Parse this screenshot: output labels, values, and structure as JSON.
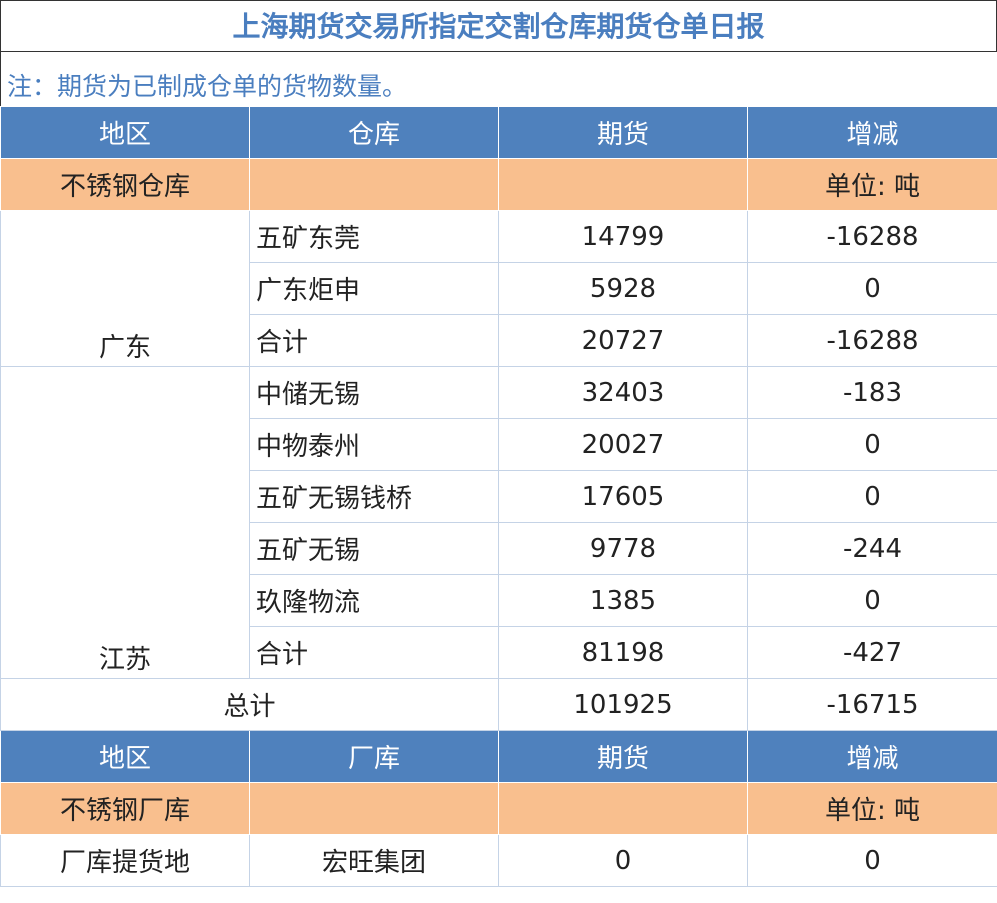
{
  "title": "上海期货交易所指定交割仓库期货仓单日报",
  "note": "注：期货为已制成仓单的货物数量。",
  "headers1": [
    "地区",
    "仓库",
    "期货",
    "增减"
  ],
  "category1": {
    "name": "不锈钢仓库",
    "unit": "单位: 吨"
  },
  "guangdong": {
    "region": "广东",
    "rows": [
      {
        "name": "五矿东莞",
        "futures": "14799",
        "change": "-16288"
      },
      {
        "name": "广东炬申",
        "futures": "5928",
        "change": "0"
      },
      {
        "name": "合计",
        "futures": "20727",
        "change": "-16288"
      }
    ]
  },
  "jiangsu": {
    "region": "江苏",
    "rows": [
      {
        "name": "中储无锡",
        "futures": "32403",
        "change": "-183"
      },
      {
        "name": "中物泰州",
        "futures": "20027",
        "change": "0"
      },
      {
        "name": "五矿无锡钱桥",
        "futures": "17605",
        "change": "0"
      },
      {
        "name": "五矿无锡",
        "futures": "9778",
        "change": "-244"
      },
      {
        "name": "玖隆物流",
        "futures": "1385",
        "change": "0"
      },
      {
        "name": "合计",
        "futures": "81198",
        "change": "-427"
      }
    ]
  },
  "grand_total": {
    "label": "总计",
    "futures": "101925",
    "change": "-16715"
  },
  "headers2": [
    "地区",
    "厂库",
    "期货",
    "增减"
  ],
  "category2": {
    "name": "不锈钢厂库",
    "unit": "单位: 吨"
  },
  "factory_row": {
    "region": "厂库提货地",
    "name": "宏旺集团",
    "futures": "0",
    "change": "0"
  }
}
